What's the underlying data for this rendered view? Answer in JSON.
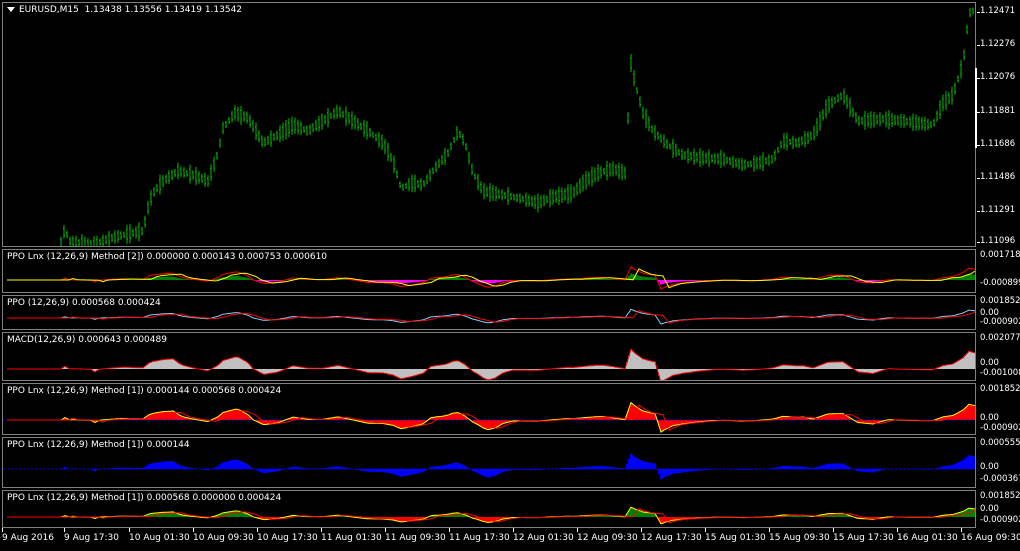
{
  "main": {
    "symbol_label": "EURUSD,M15",
    "ohlc": "1.13438 1.13556 1.13419 1.13542",
    "price_ticks": [
      "1.12471",
      "1.12276",
      "1.12076",
      "1.11881",
      "1.11686",
      "1.11486",
      "1.11291",
      "1.11096"
    ],
    "bar_color": "#00c000"
  },
  "indicators": [
    {
      "label": "PPO Lnx (12,26,9) Method [2]) 0.000000 0.000143 0.000753 0.000610",
      "ticks": [
        "0.001718",
        "-0.000899"
      ]
    },
    {
      "label": "PPO (12,26,9) 0.000568 0.000424",
      "ticks": [
        "0.001852",
        "0.00",
        "-0.000902"
      ]
    },
    {
      "label": "MACD(12,26,9) 0.000643 0.000489",
      "ticks": [
        "0.002077",
        "0.00",
        "-0.001008"
      ]
    },
    {
      "label": "PPO Lnx (12,26,9) Method [1]) 0.000144 0.000568 0.000424",
      "ticks": [
        "0.001852",
        "0.00",
        "-0.000902"
      ]
    },
    {
      "label": "PPO Lnx (12,26,9) Method [1]) 0.000144",
      "ticks": [
        "0.000555",
        "0.00",
        "-0.000367"
      ]
    },
    {
      "label": "PPO Lnx (12,26,9) Method [1]) 0.000568 0.000000 0.000424",
      "ticks": [
        "0.001852",
        "0.00",
        "-0.000902"
      ]
    }
  ],
  "time_labels": [
    "9 Aug 2016",
    "9 Aug 17:30",
    "10 Aug 01:30",
    "10 Aug 09:30",
    "10 Aug 17:30",
    "11 Aug 01:30",
    "11 Aug 09:30",
    "11 Aug 17:30",
    "12 Aug 01:30",
    "12 Aug 09:30",
    "12 Aug 17:30",
    "15 Aug 01:30",
    "15 Aug 09:30",
    "15 Aug 17:30",
    "16 Aug 01:30",
    "16 Aug 09:30"
  ],
  "colors": {
    "bull": "#00c000",
    "red": "#ff0000",
    "yellow": "#ffff00",
    "blue": "#0000ff",
    "magenta": "#ff00ff",
    "green": "#008000",
    "gray": "#c0c0c0",
    "lightblue": "#87cefa"
  }
}
